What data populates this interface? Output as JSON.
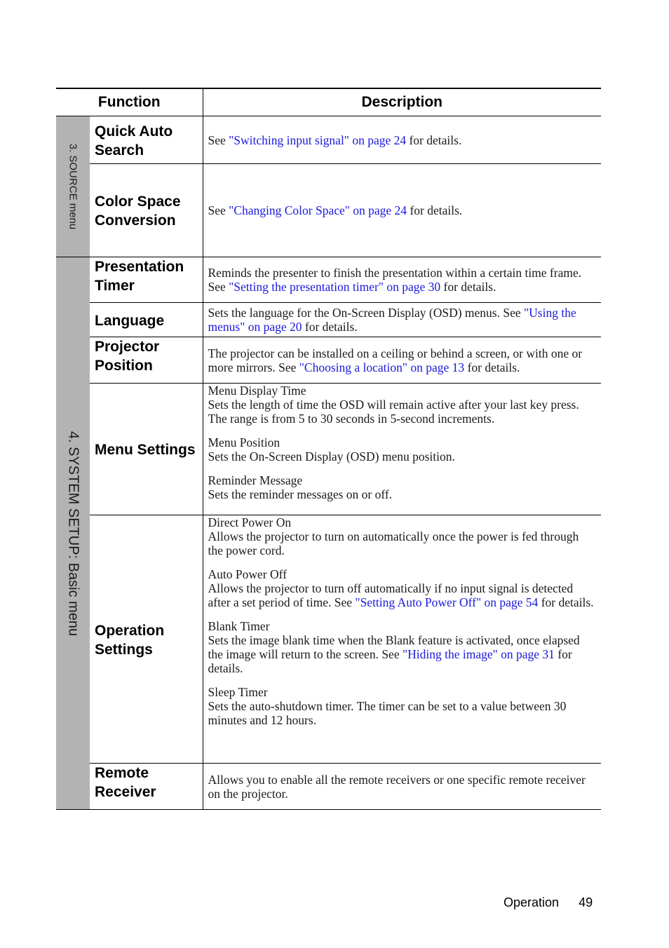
{
  "table": {
    "headers": {
      "function": "Function",
      "description": "Description"
    },
    "sections": [
      {
        "label": "3. SOURCE menu",
        "rows": [
          {
            "function": "Quick Auto Search",
            "description": [
              {
                "text": "See "
              },
              {
                "text": "\"Switching input signal\" on page 24",
                "link": true
              },
              {
                "text": " for details."
              }
            ]
          },
          {
            "function": "Color Space Conversion",
            "description": [
              {
                "text": "See "
              },
              {
                "text": "\"Changing Color Space\" on page 24",
                "link": true
              },
              {
                "text": " for details."
              }
            ]
          }
        ]
      },
      {
        "label": "4. SYSTEM SETUP: Basic menu",
        "rows": [
          {
            "function": "Presentation Timer",
            "description": [
              {
                "text": "Reminds the presenter to finish the presentation within a certain time frame. See "
              },
              {
                "text": "\"Setting the presentation timer\" on page 30",
                "link": true
              },
              {
                "text": " for details."
              }
            ]
          },
          {
            "function": "Language",
            "description": [
              {
                "text": "Sets the language for the On-Screen Display (OSD) menus. See "
              },
              {
                "text": "\"Using the menus\" on page 20",
                "link": true
              },
              {
                "text": " for details."
              }
            ]
          },
          {
            "function": "Projector Position",
            "description": [
              {
                "text": "The projector can be installed on a ceiling or behind a screen, or with one or more mirrors. See "
              },
              {
                "text": "\"Choosing a location\" on page 13",
                "link": true
              },
              {
                "text": " for details."
              }
            ]
          },
          {
            "function": "Menu Settings",
            "subitems": [
              {
                "title": "Menu Display Time",
                "body": [
                  {
                    "text": "Sets the length of time the OSD will remain active after your last key press. The range is from 5 to 30 seconds in 5-second increments."
                  }
                ]
              },
              {
                "title": "Menu Position",
                "body": [
                  {
                    "text": "Sets the On-Screen Display (OSD) menu position."
                  }
                ]
              },
              {
                "title": "Reminder Message",
                "body": [
                  {
                    "text": "Sets the reminder messages on or off."
                  }
                ]
              }
            ]
          },
          {
            "function": "Operation Settings",
            "subitems": [
              {
                "title": "Direct Power On",
                "body": [
                  {
                    "text": "Allows the projector to turn on automatically once the power is fed through the power cord."
                  }
                ]
              },
              {
                "title": "Auto Power Off",
                "body": [
                  {
                    "text": "Allows the projector to turn off automatically if no input signal is detected after a set period of time. See "
                  },
                  {
                    "text": "\"Setting Auto Power Off\" on page 54",
                    "link": true
                  },
                  {
                    "text": " for details."
                  }
                ]
              },
              {
                "title": "Blank Timer",
                "body": [
                  {
                    "text": "Sets the image blank time when the Blank feature is activated, once elapsed the image will return to the screen. See "
                  },
                  {
                    "text": "\"Hiding the image\" on page 31",
                    "link": true
                  },
                  {
                    "text": " for details."
                  }
                ]
              },
              {
                "title": "Sleep Timer",
                "body": [
                  {
                    "text": "Sets the auto-shutdown timer. The timer can be set to a value between 30 minutes and 12 hours."
                  }
                ]
              }
            ]
          },
          {
            "function": "Remote Receiver",
            "description": [
              {
                "text": "Allows you to enable all the remote receivers or one specific remote receiver on the projector."
              }
            ]
          }
        ]
      }
    ]
  },
  "footer": {
    "section": "Operation",
    "page_number": "49"
  },
  "colors": {
    "link": "#1a1adb",
    "sidebar": "#b3b3b3",
    "text": "#1a1a1a"
  }
}
